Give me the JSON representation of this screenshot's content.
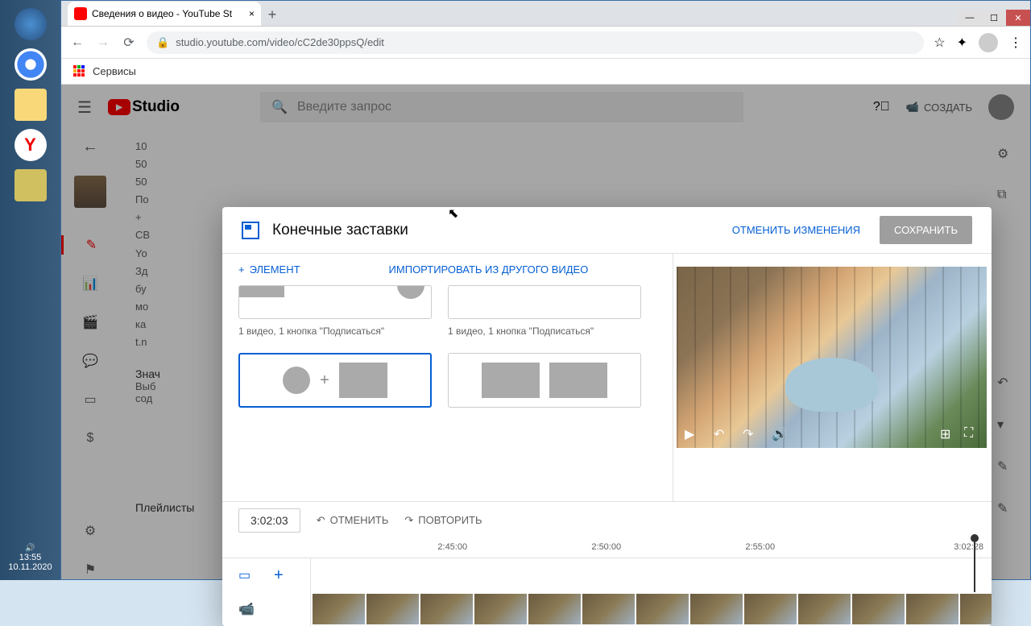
{
  "windows": {
    "time": "13:55",
    "date": "10.11.2020"
  },
  "browser": {
    "tab_title": "Сведения о видео - YouTube St",
    "url": "studio.youtube.com/video/cC2de30ppsQ/edit",
    "bookmarks_label": "Сервисы"
  },
  "yt": {
    "logo": "Studio",
    "search_placeholder": "Введите запрос",
    "create": "СОЗДАТЬ",
    "desc_lines": [
      "10",
      "50",
      "50",
      "По",
      "+",
      "СВ",
      "Yo",
      "Зд",
      "бу",
      "мо",
      "ка",
      "t.n"
    ],
    "section1": "Знач",
    "section1_sub": "Выб",
    "section1_sub2": "сод",
    "playlists": "Плейлисты"
  },
  "modal": {
    "title": "Конечные заставки",
    "cancel": "ОТМЕНИТЬ ИЗМЕНЕНИЯ",
    "save": "СОХРАНИТЬ",
    "tab_element": "ЭЛЕМЕНТ",
    "tab_import": "ИМПОРТИРОВАТЬ ИЗ ДРУГОГО ВИДЕО",
    "template_label_1": "1 видео, 1 кнопка \"Подписаться\"",
    "template_label_2": "1 видео, 1 кнопка \"Подписаться\"",
    "timeline": {
      "time": "3:02:03",
      "undo": "ОТМЕНИТЬ",
      "redo": "ПОВТОРИТЬ",
      "marks": [
        "2:45:00",
        "2:50:00",
        "2:55:00",
        "3:02:28"
      ]
    }
  }
}
